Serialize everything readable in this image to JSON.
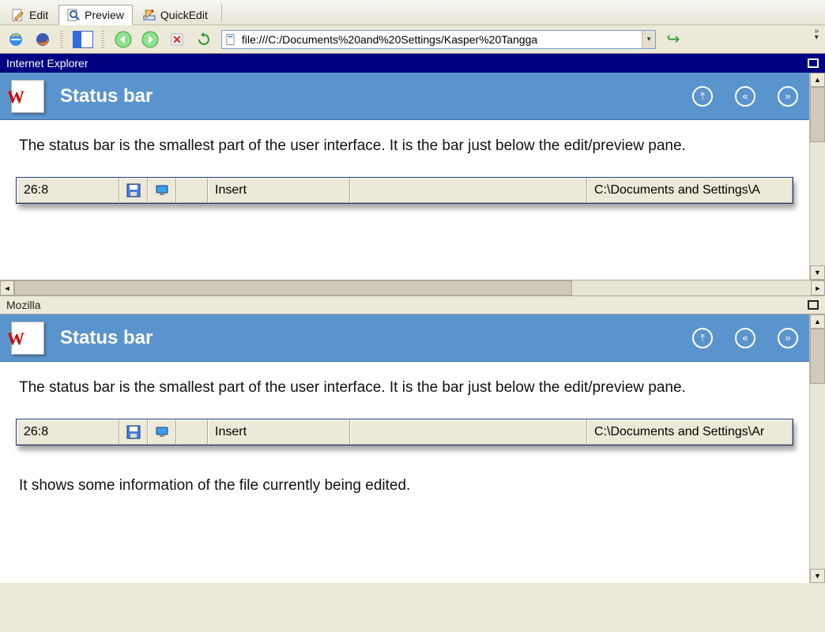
{
  "tabs": {
    "edit": "Edit",
    "preview": "Preview",
    "quickedit": "QuickEdit"
  },
  "address": {
    "url": "file:///C:/Documents%20and%20Settings/Kasper%20Tangga"
  },
  "panes": [
    {
      "browser_label": "Internet Explorer",
      "title": "Status bar",
      "body": "The status bar is the smallest part of the user interface. It is the bar just below the edit/preview pane.",
      "body_extra": null,
      "status": {
        "position": "26:8",
        "mode": "Insert",
        "path": "C:\\Documents and Settings\\A"
      }
    },
    {
      "browser_label": "Mozilla",
      "title": "Status bar",
      "body": "The status bar is the smallest part of the user interface. It is the bar just below the edit/preview pane.",
      "body_extra": "It shows some information of the file currently being edited.",
      "status": {
        "position": "26:8",
        "mode": "Insert",
        "path": "C:\\Documents and Settings\\Ar"
      }
    }
  ]
}
